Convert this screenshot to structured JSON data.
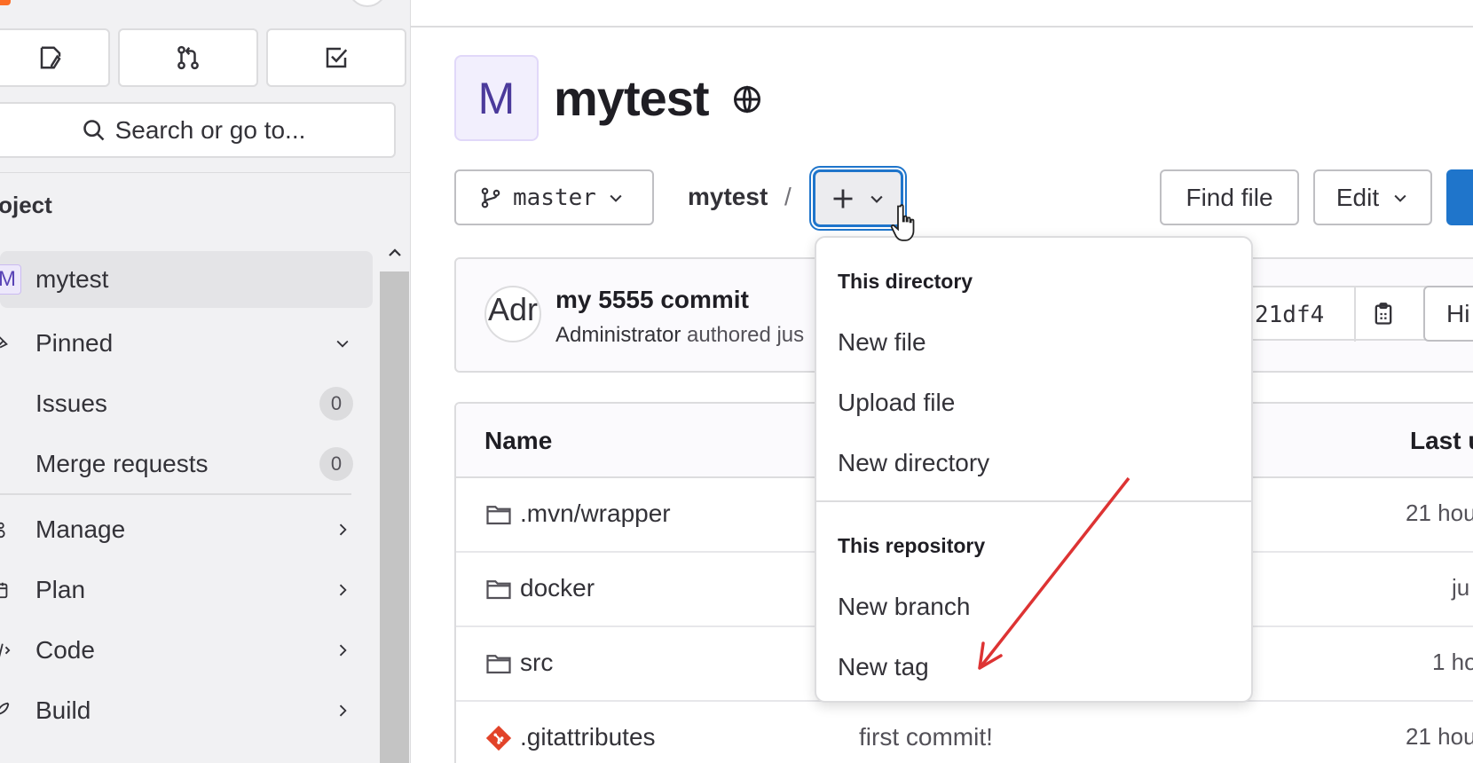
{
  "sidebar": {
    "search_placeholder": "Search or go to...",
    "section_title": "roject",
    "project_item": {
      "avatar_letter": "M",
      "label": "mytest"
    },
    "pinned": {
      "label": "Pinned"
    },
    "pinned_items": [
      {
        "label": "Issues",
        "count": "0"
      },
      {
        "label": "Merge requests",
        "count": "0"
      }
    ],
    "menu": [
      {
        "label": "Manage",
        "icon": "users-icon"
      },
      {
        "label": "Plan",
        "icon": "calendar-icon"
      },
      {
        "label": "Code",
        "icon": "code-icon"
      },
      {
        "label": "Build",
        "icon": "rocket-icon"
      }
    ]
  },
  "project": {
    "avatar_letter": "M",
    "title": "mytest",
    "visibility_icon": "globe-icon"
  },
  "toolbar": {
    "branch": "master",
    "breadcrumb_root": "mytest",
    "breadcrumb_sep": "/",
    "find_file": "Find file",
    "edit": "Edit"
  },
  "commit": {
    "avatar_text": "Adr",
    "title": "my 5555 commit",
    "author": "Administrator",
    "meta_rest": "authored jus",
    "sha": "21df4",
    "history_label": "Hi"
  },
  "file_table": {
    "col_name": "Name",
    "col_last": "Last u",
    "rows": [
      {
        "type": "folder",
        "name": ".mvn/wrapper",
        "commit": "",
        "time": "21 hou"
      },
      {
        "type": "folder",
        "name": "docker",
        "commit": "",
        "time": "ju"
      },
      {
        "type": "folder",
        "name": "src",
        "commit": "",
        "time": "1 ho"
      },
      {
        "type": "git",
        "name": ".gitattributes",
        "commit": "first commit!",
        "time": "21 hou"
      }
    ]
  },
  "dropdown": {
    "directory_header": "This directory",
    "directory_items": [
      "New file",
      "Upload file",
      "New directory"
    ],
    "repository_header": "This repository",
    "repository_items": [
      "New branch",
      "New tag"
    ]
  },
  "colors": {
    "accent": "#1f75cb",
    "annotation_arrow": "#dd3333",
    "git_icon": "#e24329"
  }
}
